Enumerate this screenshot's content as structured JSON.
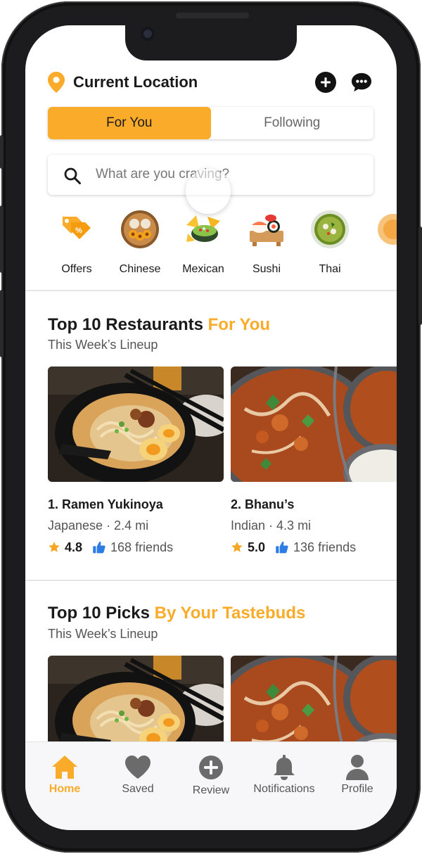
{
  "header": {
    "location_title": "Current Location"
  },
  "tabs": [
    {
      "label": "For You",
      "active": true
    },
    {
      "label": "Following",
      "active": false
    }
  ],
  "search": {
    "placeholder": "What are you craving?"
  },
  "categories": [
    {
      "label": "Offers",
      "icon": "offers-tag-icon"
    },
    {
      "label": "Chinese",
      "icon": "dim-sum-icon"
    },
    {
      "label": "Mexican",
      "icon": "nachos-icon"
    },
    {
      "label": "Sushi",
      "icon": "sushi-icon"
    },
    {
      "label": "Thai",
      "icon": "thai-curry-icon"
    }
  ],
  "sections": [
    {
      "title": "Top 10 Restaurants ",
      "title_accent": "For You",
      "subtitle": "This Week’s Lineup",
      "cards": [
        {
          "name": "1. Ramen Yukinoya",
          "meta": "Japanese · 2.4 mi",
          "rating": "4.8",
          "friends": "168 friends",
          "image": "ramen-photo"
        },
        {
          "name": "2. Bhanu’s",
          "meta": "Indian · 4.3 mi",
          "rating": "5.0",
          "friends": "136 friends",
          "image": "curry-photo"
        }
      ]
    },
    {
      "title": "Top 10 Picks ",
      "title_accent": "By Your Tastebuds",
      "subtitle": "This Week’s Lineup",
      "cards": [
        {
          "image": "ramen-photo"
        },
        {
          "image": "curry-photo"
        }
      ]
    }
  ],
  "bottom_nav": [
    {
      "label": "Home",
      "icon": "home-icon",
      "active": true
    },
    {
      "label": "Saved",
      "icon": "heart-icon",
      "active": false
    },
    {
      "label": "Review",
      "icon": "plus-circle-icon",
      "active": false
    },
    {
      "label": "Notifications",
      "icon": "bell-icon",
      "active": false
    },
    {
      "label": "Profile",
      "icon": "person-icon",
      "active": false
    }
  ],
  "colors": {
    "accent": "#fbab2a",
    "text": "#1a1a1a",
    "muted": "#555555",
    "star": "#f5a623",
    "thumb": "#2d7be5"
  }
}
